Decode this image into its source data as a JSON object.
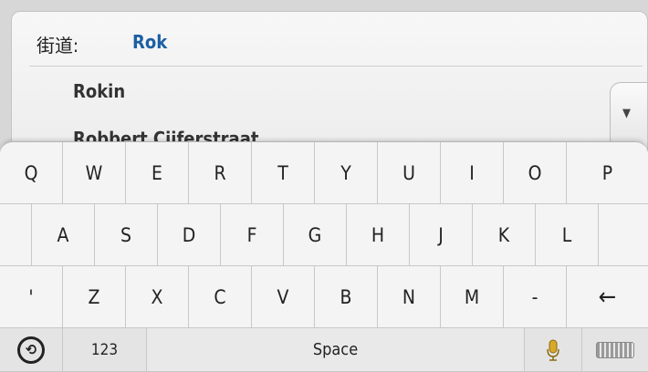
{
  "search": {
    "label": "街道:",
    "value": "Rok",
    "suggestions": [
      "Rokin",
      "Robbert Cijferstraat"
    ],
    "scroll_icon": "chevron-down-icon"
  },
  "keyboard": {
    "row1": [
      "Q",
      "W",
      "E",
      "R",
      "T",
      "Y",
      "U",
      "I",
      "O",
      "P"
    ],
    "row2": [
      "A",
      "S",
      "D",
      "F",
      "G",
      "H",
      "J",
      "K",
      "L"
    ],
    "row3": [
      "'",
      "Z",
      "X",
      "C",
      "V",
      "B",
      "N",
      "M",
      "-"
    ],
    "backspace_icon": "←",
    "numbers_label": "123",
    "space_label": "Space",
    "back_icon": "⟲",
    "mic_icon": "microphone-icon",
    "keyboard_icon": "keyboard-icon"
  }
}
